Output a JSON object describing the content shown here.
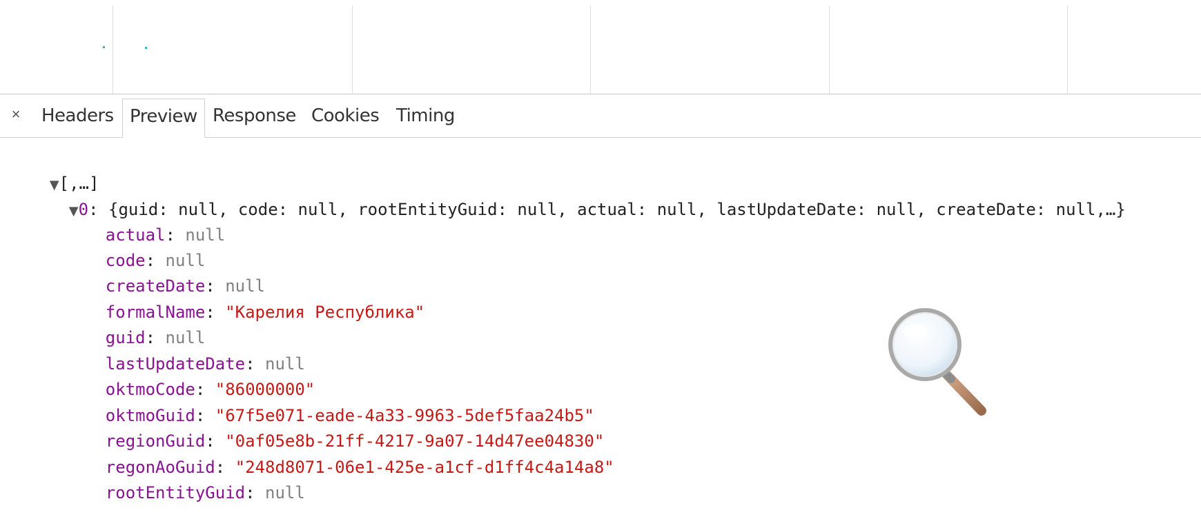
{
  "timeline": {
    "dots": 2
  },
  "tabs": {
    "close_label": "×",
    "items": [
      {
        "label": "Headers",
        "active": false
      },
      {
        "label": "Preview",
        "active": true
      },
      {
        "label": "Response",
        "active": false
      },
      {
        "label": "Cookies",
        "active": false
      },
      {
        "label": "Timing",
        "active": false
      }
    ]
  },
  "preview": {
    "root_label": "[,…]",
    "item0_index": "0",
    "item0_summary": "{guid: null, code: null, rootEntityGuid: null, actual: null, lastUpdateDate: null, createDate: null,…}",
    "fields": [
      {
        "key": "actual",
        "value": "null",
        "type": "null"
      },
      {
        "key": "code",
        "value": "null",
        "type": "null"
      },
      {
        "key": "createDate",
        "value": "null",
        "type": "null"
      },
      {
        "key": "formalName",
        "value": "\"Карелия Республика\"",
        "type": "string"
      },
      {
        "key": "guid",
        "value": "null",
        "type": "null"
      },
      {
        "key": "lastUpdateDate",
        "value": "null",
        "type": "null"
      },
      {
        "key": "oktmoCode",
        "value": "\"86000000\"",
        "type": "string"
      },
      {
        "key": "oktmoGuid",
        "value": "\"67f5e071-eade-4a33-9963-5def5faa24b5\"",
        "type": "string"
      },
      {
        "key": "regionGuid",
        "value": "\"0af05e8b-21ff-4217-9a07-14d47ee04830\"",
        "type": "string"
      },
      {
        "key": "regonAoGuid",
        "value": "\"248d8071-06e1-425e-a1cf-d1ff4c4a14a8\"",
        "type": "string"
      },
      {
        "key": "rootEntityGuid",
        "value": "null",
        "type": "null"
      }
    ]
  },
  "icons": {
    "expand": "triangle-down-icon",
    "magnifier": "magnifier-icon"
  }
}
